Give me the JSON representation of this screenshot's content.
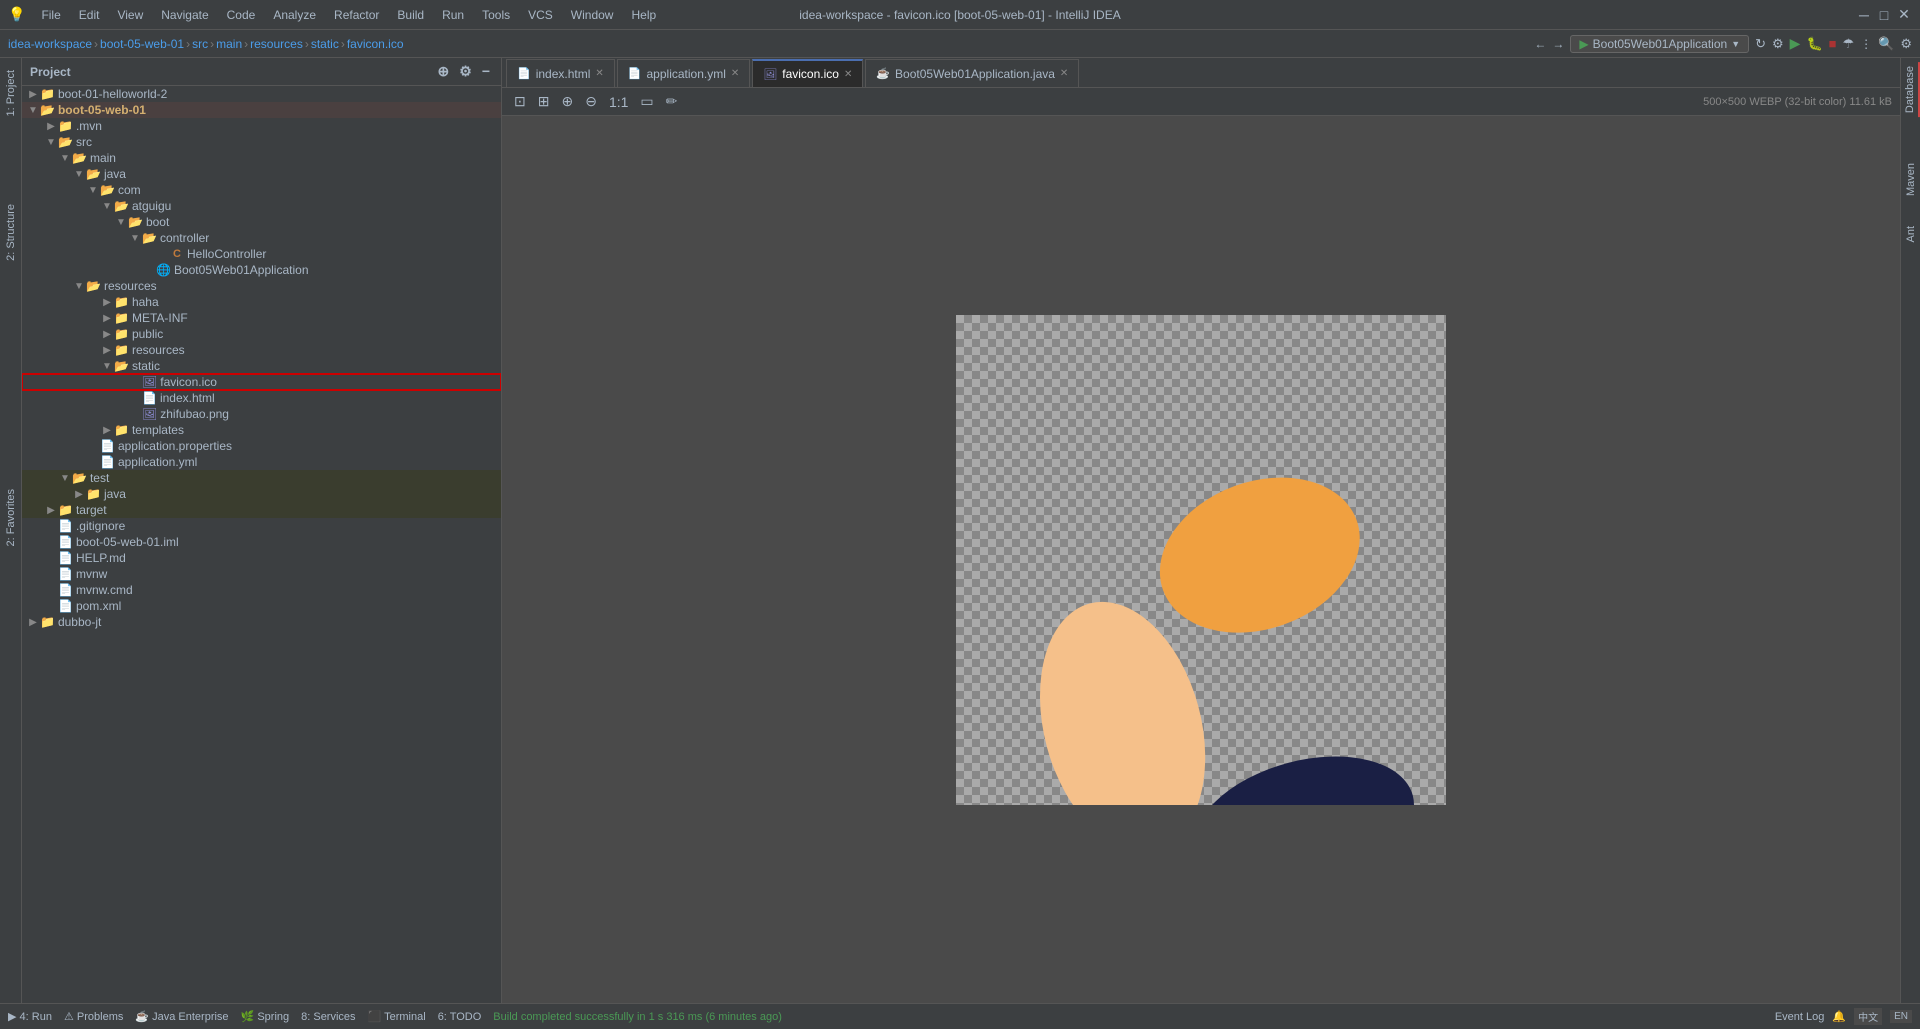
{
  "window": {
    "title": "idea-workspace - favicon.ico [boot-05-web-01] - IntelliJ IDEA",
    "breadcrumb": [
      "idea-workspace",
      "boot-05-web-01",
      "src",
      "main",
      "resources",
      "static",
      "favicon.ico"
    ]
  },
  "menu": {
    "items": [
      "File",
      "Edit",
      "View",
      "Navigate",
      "Code",
      "Analyze",
      "Refactor",
      "Build",
      "Run",
      "Tools",
      "VCS",
      "Window",
      "Help"
    ]
  },
  "panel": {
    "title": "Project",
    "run_config": "Boot05Web01Application"
  },
  "tabs": [
    {
      "label": "index.html",
      "icon": "html",
      "active": false,
      "closable": true
    },
    {
      "label": "application.yml",
      "icon": "yaml",
      "active": false,
      "closable": true
    },
    {
      "label": "favicon.ico",
      "icon": "img",
      "active": true,
      "closable": true
    },
    {
      "label": "Boot05Web01Application.java",
      "icon": "java",
      "active": false,
      "closable": true
    }
  ],
  "image_info": "500×500 WEBP (32-bit color) 11.61 kB",
  "tree": [
    {
      "id": "boot-01",
      "label": "boot-01-helloworld-2",
      "level": 0,
      "type": "module",
      "expanded": false,
      "arrow": "▶"
    },
    {
      "id": "boot-05",
      "label": "boot-05-web-01",
      "level": 0,
      "type": "module",
      "expanded": true,
      "arrow": "▼"
    },
    {
      "id": "mvn",
      "label": ".mvn",
      "level": 1,
      "type": "folder",
      "expanded": false,
      "arrow": "▶"
    },
    {
      "id": "src",
      "label": "src",
      "level": 1,
      "type": "folder",
      "expanded": true,
      "arrow": "▼"
    },
    {
      "id": "main",
      "label": "main",
      "level": 2,
      "type": "folder",
      "expanded": true,
      "arrow": "▼"
    },
    {
      "id": "java",
      "label": "java",
      "level": 3,
      "type": "folder",
      "expanded": true,
      "arrow": "▼"
    },
    {
      "id": "com",
      "label": "com",
      "level": 4,
      "type": "folder",
      "expanded": true,
      "arrow": "▼"
    },
    {
      "id": "atguigu",
      "label": "atguigu",
      "level": 5,
      "type": "folder",
      "expanded": true,
      "arrow": "▼"
    },
    {
      "id": "boot",
      "label": "boot",
      "level": 6,
      "type": "folder",
      "expanded": true,
      "arrow": "▼"
    },
    {
      "id": "controller",
      "label": "controller",
      "level": 7,
      "type": "folder",
      "expanded": true,
      "arrow": "▼"
    },
    {
      "id": "HelloController",
      "label": "HelloController",
      "level": 8,
      "type": "java",
      "expanded": false,
      "arrow": ""
    },
    {
      "id": "Boot05App",
      "label": "Boot05Web01Application",
      "level": 7,
      "type": "java-spring",
      "expanded": false,
      "arrow": ""
    },
    {
      "id": "resources",
      "label": "resources",
      "level": 3,
      "type": "folder",
      "expanded": true,
      "arrow": "▼"
    },
    {
      "id": "haha",
      "label": "haha",
      "level": 4,
      "type": "folder",
      "expanded": false,
      "arrow": "▶"
    },
    {
      "id": "META-INF",
      "label": "META-INF",
      "level": 4,
      "type": "folder",
      "expanded": false,
      "arrow": "▶"
    },
    {
      "id": "public",
      "label": "public",
      "level": 4,
      "type": "folder",
      "expanded": false,
      "arrow": "▶"
    },
    {
      "id": "resources2",
      "label": "resources",
      "level": 4,
      "type": "folder",
      "expanded": false,
      "arrow": "▶"
    },
    {
      "id": "static",
      "label": "static",
      "level": 4,
      "type": "folder",
      "expanded": true,
      "arrow": "▼"
    },
    {
      "id": "favicon",
      "label": "favicon.ico",
      "level": 5,
      "type": "ico",
      "expanded": false,
      "arrow": "",
      "selected": true
    },
    {
      "id": "index",
      "label": "index.html",
      "level": 5,
      "type": "html",
      "expanded": false,
      "arrow": ""
    },
    {
      "id": "zhifubao",
      "label": "zhifubao.png",
      "level": 5,
      "type": "img",
      "expanded": false,
      "arrow": ""
    },
    {
      "id": "templates",
      "label": "templates",
      "level": 4,
      "type": "folder",
      "expanded": false,
      "arrow": "▶"
    },
    {
      "id": "app_props",
      "label": "application.properties",
      "level": 3,
      "type": "properties",
      "expanded": false,
      "arrow": ""
    },
    {
      "id": "app_yaml",
      "label": "application.yml",
      "level": 3,
      "type": "yaml",
      "expanded": false,
      "arrow": ""
    },
    {
      "id": "test",
      "label": "test",
      "level": 2,
      "type": "folder",
      "expanded": true,
      "arrow": "▼"
    },
    {
      "id": "test_java",
      "label": "java",
      "level": 3,
      "type": "folder",
      "expanded": false,
      "arrow": "▶"
    },
    {
      "id": "target",
      "label": "target",
      "level": 1,
      "type": "folder",
      "expanded": false,
      "arrow": "▶"
    },
    {
      "id": "gitignore",
      "label": ".gitignore",
      "level": 1,
      "type": "file",
      "expanded": false,
      "arrow": ""
    },
    {
      "id": "iml",
      "label": "boot-05-web-01.iml",
      "level": 1,
      "type": "iml",
      "expanded": false,
      "arrow": ""
    },
    {
      "id": "helpmd",
      "label": "HELP.md",
      "level": 1,
      "type": "md",
      "expanded": false,
      "arrow": ""
    },
    {
      "id": "mvnw",
      "label": "mvnw",
      "level": 1,
      "type": "file",
      "expanded": false,
      "arrow": ""
    },
    {
      "id": "mvnwcmd",
      "label": "mvnw.cmd",
      "level": 1,
      "type": "file",
      "expanded": false,
      "arrow": ""
    },
    {
      "id": "pomxml",
      "label": "pom.xml",
      "level": 1,
      "type": "xml",
      "expanded": false,
      "arrow": ""
    },
    {
      "id": "dubbo",
      "label": "dubbo-jt",
      "level": 0,
      "type": "module",
      "expanded": false,
      "arrow": "▶"
    }
  ],
  "status_bar": {
    "run_label": "4: Run",
    "problems_label": "Problems",
    "java_enterprise": "Java Enterprise",
    "spring_label": "Spring",
    "services_label": "8: Services",
    "terminal_label": "Terminal",
    "todo_label": "6: TODO",
    "build_status": "Build completed successfully in 1 s 316 ms (6 minutes ago)",
    "event_log": "Event Log"
  },
  "sidebar_tabs": {
    "left": [
      "1: Project",
      "2: Favorites"
    ],
    "right": [
      "Database",
      "Maven",
      "Ant"
    ]
  }
}
